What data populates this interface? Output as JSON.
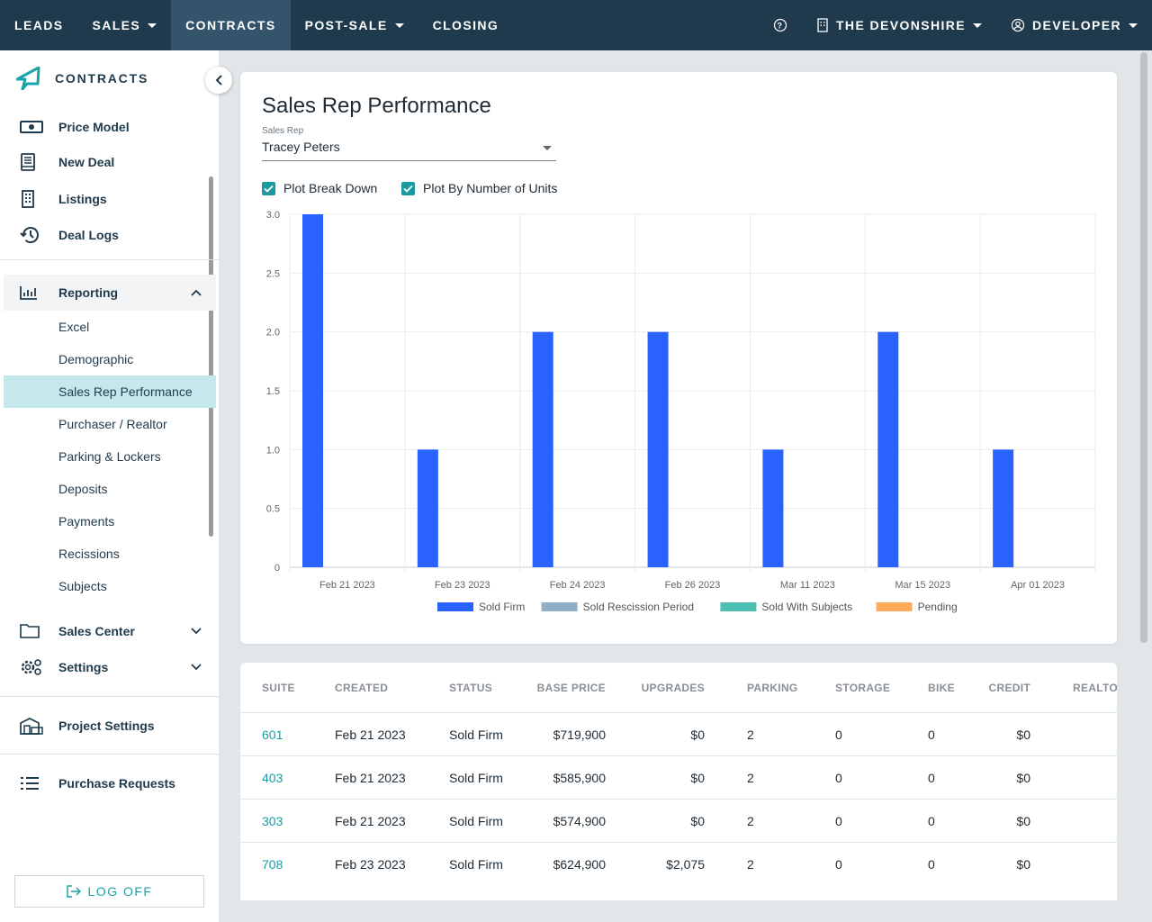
{
  "topnav": {
    "items": [
      {
        "label": "LEADS",
        "dropdown": false
      },
      {
        "label": "SALES",
        "dropdown": true
      },
      {
        "label": "CONTRACTS",
        "dropdown": false,
        "active": true
      },
      {
        "label": "POST-SALE",
        "dropdown": true
      },
      {
        "label": "CLOSING",
        "dropdown": false
      }
    ],
    "project": "THE DEVONSHIRE",
    "user": "DEVELOPER",
    "help_icon": "help-circle-icon"
  },
  "sidebar": {
    "title": "CONTRACTS",
    "items": [
      {
        "label": "Price Model",
        "icon": "money-icon"
      },
      {
        "label": "New Deal",
        "icon": "book-icon"
      },
      {
        "label": "Listings",
        "icon": "building-icon"
      },
      {
        "label": "Deal Logs",
        "icon": "history-icon"
      }
    ],
    "reporting": {
      "label": "Reporting",
      "icon": "bar-chart-icon",
      "expanded": true,
      "children": [
        "Excel",
        "Demographic",
        "Sales Rep Performance",
        "Purchaser / Realtor",
        "Parking & Lockers",
        "Deposits",
        "Payments",
        "Recissions",
        "Subjects"
      ],
      "active": "Sales Rep Performance"
    },
    "sales_center": "Sales Center",
    "settings": "Settings",
    "project_settings": "Project Settings",
    "purchase_requests": "Purchase Requests",
    "logoff": "LOG OFF"
  },
  "main": {
    "title": "Sales Rep Performance",
    "sales_rep_label": "Sales Rep",
    "sales_rep_value": "Tracey Peters",
    "checkboxes": [
      {
        "label": "Plot Break Down",
        "checked": true
      },
      {
        "label": "Plot By Number of Units",
        "checked": true
      }
    ]
  },
  "chart_data": {
    "type": "bar",
    "categories": [
      "Feb 21 2023",
      "Feb 23 2023",
      "Feb 24 2023",
      "Feb 26 2023",
      "Mar 11 2023",
      "Mar 15 2023",
      "Apr 01 2023"
    ],
    "series": [
      {
        "name": "Sold Firm",
        "color": "#2962ff",
        "values": [
          3,
          1,
          2,
          2,
          1,
          2,
          1
        ]
      },
      {
        "name": "Sold Rescission Period",
        "color": "#90aec6",
        "values": [
          0,
          0,
          0,
          0,
          0,
          0,
          0
        ]
      },
      {
        "name": "Sold With Subjects",
        "color": "#4dbfb3",
        "values": [
          0,
          0,
          0,
          0,
          0,
          0,
          0
        ]
      },
      {
        "name": "Pending",
        "color": "#ffab5a",
        "values": [
          0,
          0,
          0,
          0,
          0,
          0,
          0
        ]
      }
    ],
    "yticks": [
      "0",
      "0.5",
      "1.0",
      "1.5",
      "2.0",
      "2.5",
      "3.0"
    ],
    "ylim": [
      0,
      3
    ],
    "grid": true,
    "legend": "bottom"
  },
  "table": {
    "columns": [
      "SUITE",
      "CREATED",
      "STATUS",
      "BASE PRICE",
      "UPGRADES",
      "PARKING",
      "STORAGE",
      "BIKE",
      "CREDIT",
      "REALTOR"
    ],
    "rows": [
      [
        "601",
        "Feb 21 2023",
        "Sold Firm",
        "$719,900",
        "$0",
        "2",
        "0",
        "0",
        "$0",
        ""
      ],
      [
        "403",
        "Feb 21 2023",
        "Sold Firm",
        "$585,900",
        "$0",
        "2",
        "0",
        "0",
        "$0",
        ""
      ],
      [
        "303",
        "Feb 21 2023",
        "Sold Firm",
        "$574,900",
        "$0",
        "2",
        "0",
        "0",
        "$0",
        ""
      ],
      [
        "708",
        "Feb 23 2023",
        "Sold Firm",
        "$624,900",
        "$2,075",
        "2",
        "0",
        "0",
        "$0",
        ""
      ]
    ]
  }
}
